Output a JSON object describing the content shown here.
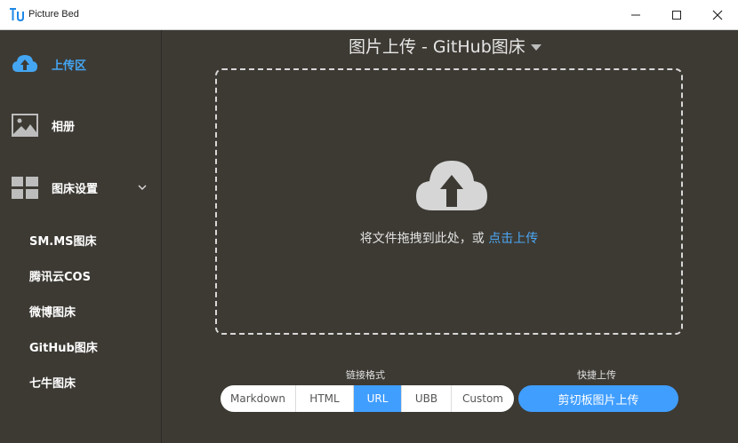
{
  "window": {
    "title": "Picture Bed",
    "controls": [
      "minimize-icon",
      "maximize-icon",
      "close-icon"
    ]
  },
  "sidebar": {
    "items": [
      {
        "label": "上传区",
        "icon": "cloud-upload-icon",
        "active": true
      },
      {
        "label": "相册",
        "icon": "image-icon",
        "active": false
      },
      {
        "label": "图床设置",
        "icon": "grid-icon",
        "active": false,
        "expanded": true
      }
    ],
    "sub_items": [
      {
        "label": "SM.MS图床"
      },
      {
        "label": "腾讯云COS"
      },
      {
        "label": "微博图床"
      },
      {
        "label": "GitHub图床"
      },
      {
        "label": "七牛图床"
      }
    ]
  },
  "main": {
    "title": "图片上传 - GitHub图床",
    "dropzone": {
      "text": "将文件拖拽到此处，或 ",
      "link": "点击上传",
      "icon": "cloud-upload-icon"
    },
    "link_format": {
      "label": "链接格式",
      "options": [
        "Markdown",
        "HTML",
        "URL",
        "UBB",
        "Custom"
      ],
      "selected": "URL"
    },
    "quick_upload": {
      "label": "快捷上传",
      "button": "剪切板图片上传"
    }
  },
  "colors": {
    "background": "#3d3a34",
    "accent": "#409eff",
    "active_text": "#44a6f3",
    "titlebar": "#ffffff"
  }
}
